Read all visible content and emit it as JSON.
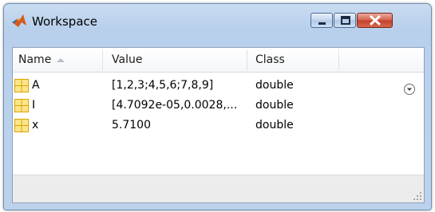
{
  "window": {
    "title": "Workspace",
    "icon": "matlab-logo-icon",
    "controls": [
      "minimize-icon",
      "maximize-icon",
      "close-icon"
    ]
  },
  "table": {
    "columns": [
      {
        "label": "Name",
        "sorted": "ascending"
      },
      {
        "label": "Value"
      },
      {
        "label": "Class"
      }
    ],
    "rows": [
      {
        "name": "A",
        "value": "[1,2,3;4,5,6;7,8,9]",
        "class": "double"
      },
      {
        "name": "I",
        "value": "[4.7092e-05,0.0028,...",
        "class": "double"
      },
      {
        "name": "x",
        "value": "5.7100",
        "class": "double"
      }
    ]
  },
  "colors": {
    "titlebar": "#c9dcf1",
    "close_button": "#c2402a",
    "variable_icon": "#f3c623"
  }
}
